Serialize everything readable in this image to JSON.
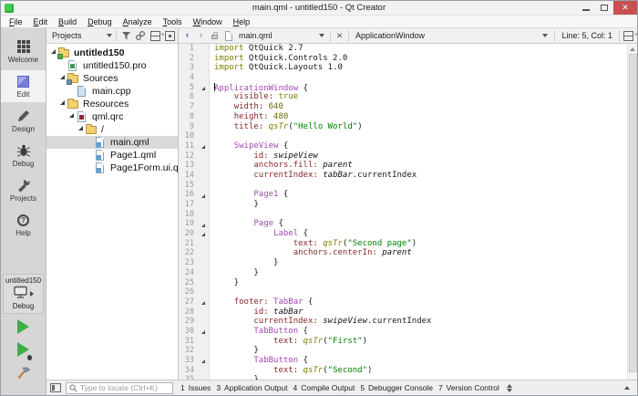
{
  "window": {
    "title": "main.qml - untitled150 - Qt Creator",
    "controls": {
      "minimize": "–",
      "maximize": "▢",
      "close": "✕"
    }
  },
  "menubar": {
    "items": [
      "File",
      "Edit",
      "Build",
      "Debug",
      "Analyze",
      "Tools",
      "Window",
      "Help"
    ]
  },
  "sidebar": {
    "modes": [
      {
        "id": "welcome",
        "label": "Welcome",
        "active": false
      },
      {
        "id": "edit",
        "label": "Edit",
        "active": true
      },
      {
        "id": "design",
        "label": "Design",
        "active": false
      },
      {
        "id": "debug",
        "label": "Debug",
        "active": false
      },
      {
        "id": "projects",
        "label": "Projects",
        "active": false
      },
      {
        "id": "help",
        "label": "Help",
        "active": false
      }
    ],
    "kit": {
      "project": "untitled150",
      "config": "Debug"
    },
    "run_buttons": [
      {
        "id": "run",
        "icon": "run-icon"
      },
      {
        "id": "debug-run",
        "icon": "debug-run-icon"
      },
      {
        "id": "build",
        "icon": "build-hammer-icon"
      }
    ]
  },
  "projects_pane": {
    "header": {
      "selector": "Projects",
      "icons": [
        "filter",
        "link-with-editor",
        "split",
        "close"
      ]
    },
    "tree": [
      {
        "label": "untitled150",
        "depth": 0,
        "icon": "folder-project",
        "expanded": true,
        "bold": true,
        "selected": false
      },
      {
        "label": "untitled150.pro",
        "depth": 1,
        "icon": "file-pro",
        "expanded": null,
        "bold": false,
        "selected": false
      },
      {
        "label": "Sources",
        "depth": 1,
        "icon": "folder-sources",
        "expanded": true,
        "bold": false,
        "selected": false
      },
      {
        "label": "main.cpp",
        "depth": 2,
        "icon": "file-cpp",
        "expanded": null,
        "bold": false,
        "selected": false
      },
      {
        "label": "Resources",
        "depth": 1,
        "icon": "folder-resources",
        "expanded": true,
        "bold": false,
        "selected": false
      },
      {
        "label": "qml.qrc",
        "depth": 2,
        "icon": "file-qrc",
        "expanded": true,
        "bold": false,
        "selected": false
      },
      {
        "label": "/",
        "depth": 3,
        "icon": "folder-plain",
        "expanded": true,
        "bold": false,
        "selected": false
      },
      {
        "label": "main.qml",
        "depth": 4,
        "icon": "file-qml",
        "expanded": null,
        "bold": false,
        "selected": true
      },
      {
        "label": "Page1.qml",
        "depth": 4,
        "icon": "file-qml",
        "expanded": null,
        "bold": false,
        "selected": false
      },
      {
        "label": "Page1Form.ui.qml",
        "depth": 4,
        "icon": "file-qml",
        "expanded": null,
        "bold": false,
        "selected": false
      }
    ]
  },
  "editor": {
    "toolbar": {
      "file_selector": "main.qml",
      "context_selector": "ApplicationWindow",
      "cursor_position": "Line: 5, Col: 1"
    },
    "lines": [
      {
        "n": 1,
        "fold": false,
        "cursor": false,
        "tokens": [
          [
            "kw",
            "import"
          ],
          [
            "pl",
            " QtQuick 2.7"
          ]
        ]
      },
      {
        "n": 2,
        "fold": false,
        "cursor": false,
        "tokens": [
          [
            "kw",
            "import"
          ],
          [
            "pl",
            " QtQuick.Controls 2.0"
          ]
        ]
      },
      {
        "n": 3,
        "fold": false,
        "cursor": false,
        "tokens": [
          [
            "kw",
            "import"
          ],
          [
            "pl",
            " QtQuick.Layouts 1.0"
          ]
        ]
      },
      {
        "n": 4,
        "fold": false,
        "cursor": false,
        "tokens": []
      },
      {
        "n": 5,
        "fold": true,
        "cursor": true,
        "tokens": [
          [
            "ty",
            "ApplicationWindow"
          ],
          [
            "pl",
            " {"
          ]
        ]
      },
      {
        "n": 6,
        "fold": false,
        "cursor": false,
        "tokens": [
          [
            "pl",
            "    "
          ],
          [
            "pr",
            "visible:"
          ],
          [
            "pl",
            " "
          ],
          [
            "kw",
            "true"
          ]
        ]
      },
      {
        "n": 7,
        "fold": false,
        "cursor": false,
        "tokens": [
          [
            "pl",
            "    "
          ],
          [
            "pr",
            "width:"
          ],
          [
            "pl",
            " "
          ],
          [
            "nu",
            "640"
          ]
        ]
      },
      {
        "n": 8,
        "fold": false,
        "cursor": false,
        "tokens": [
          [
            "pl",
            "    "
          ],
          [
            "pr",
            "height:"
          ],
          [
            "pl",
            " "
          ],
          [
            "nu",
            "480"
          ]
        ]
      },
      {
        "n": 9,
        "fold": false,
        "cursor": false,
        "tokens": [
          [
            "pl",
            "    "
          ],
          [
            "pr",
            "title:"
          ],
          [
            "pl",
            " "
          ],
          [
            "fn",
            "qsTr"
          ],
          [
            "pl",
            "("
          ],
          [
            "st",
            "\"Hello World\""
          ],
          [
            "pl",
            ")"
          ]
        ]
      },
      {
        "n": 10,
        "fold": false,
        "cursor": false,
        "tokens": []
      },
      {
        "n": 11,
        "fold": true,
        "cursor": false,
        "tokens": [
          [
            "pl",
            "    "
          ],
          [
            "ty",
            "SwipeView"
          ],
          [
            "pl",
            " {"
          ]
        ]
      },
      {
        "n": 12,
        "fold": false,
        "cursor": false,
        "tokens": [
          [
            "pl",
            "        "
          ],
          [
            "pr",
            "id:"
          ],
          [
            "pl",
            " "
          ],
          [
            "it",
            "swipeView"
          ]
        ]
      },
      {
        "n": 13,
        "fold": false,
        "cursor": false,
        "tokens": [
          [
            "pl",
            "        "
          ],
          [
            "pr",
            "anchors.fill:"
          ],
          [
            "pl",
            " "
          ],
          [
            "it",
            "parent"
          ]
        ]
      },
      {
        "n": 14,
        "fold": false,
        "cursor": false,
        "tokens": [
          [
            "pl",
            "        "
          ],
          [
            "pr",
            "currentIndex:"
          ],
          [
            "pl",
            " "
          ],
          [
            "it",
            "tabBar"
          ],
          [
            "pl",
            ".currentIndex"
          ]
        ]
      },
      {
        "n": 15,
        "fold": false,
        "cursor": false,
        "tokens": []
      },
      {
        "n": 16,
        "fold": true,
        "cursor": false,
        "tokens": [
          [
            "pl",
            "        "
          ],
          [
            "ty",
            "Page1"
          ],
          [
            "pl",
            " {"
          ]
        ]
      },
      {
        "n": 17,
        "fold": false,
        "cursor": false,
        "tokens": [
          [
            "pl",
            "        }"
          ]
        ]
      },
      {
        "n": 18,
        "fold": false,
        "cursor": false,
        "tokens": []
      },
      {
        "n": 19,
        "fold": true,
        "cursor": false,
        "tokens": [
          [
            "pl",
            "        "
          ],
          [
            "ty",
            "Page"
          ],
          [
            "pl",
            " {"
          ]
        ]
      },
      {
        "n": 20,
        "fold": true,
        "cursor": false,
        "tokens": [
          [
            "pl",
            "            "
          ],
          [
            "ty",
            "Label"
          ],
          [
            "pl",
            " {"
          ]
        ]
      },
      {
        "n": 21,
        "fold": false,
        "cursor": false,
        "tokens": [
          [
            "pl",
            "                "
          ],
          [
            "pr",
            "text:"
          ],
          [
            "pl",
            " "
          ],
          [
            "fn",
            "qsTr"
          ],
          [
            "pl",
            "("
          ],
          [
            "st",
            "\"Second page\""
          ],
          [
            "pl",
            ")"
          ]
        ]
      },
      {
        "n": 22,
        "fold": false,
        "cursor": false,
        "tokens": [
          [
            "pl",
            "                "
          ],
          [
            "pr",
            "anchors.centerIn:"
          ],
          [
            "pl",
            " "
          ],
          [
            "it",
            "parent"
          ]
        ]
      },
      {
        "n": 23,
        "fold": false,
        "cursor": false,
        "tokens": [
          [
            "pl",
            "            }"
          ]
        ]
      },
      {
        "n": 24,
        "fold": false,
        "cursor": false,
        "tokens": [
          [
            "pl",
            "        }"
          ]
        ]
      },
      {
        "n": 25,
        "fold": false,
        "cursor": false,
        "tokens": [
          [
            "pl",
            "    }"
          ]
        ]
      },
      {
        "n": 26,
        "fold": false,
        "cursor": false,
        "tokens": []
      },
      {
        "n": 27,
        "fold": true,
        "cursor": false,
        "tokens": [
          [
            "pl",
            "    "
          ],
          [
            "pr",
            "footer:"
          ],
          [
            "pl",
            " "
          ],
          [
            "ty",
            "TabBar"
          ],
          [
            "pl",
            " {"
          ]
        ]
      },
      {
        "n": 28,
        "fold": false,
        "cursor": false,
        "tokens": [
          [
            "pl",
            "        "
          ],
          [
            "pr",
            "id:"
          ],
          [
            "pl",
            " "
          ],
          [
            "it",
            "tabBar"
          ]
        ]
      },
      {
        "n": 29,
        "fold": false,
        "cursor": false,
        "tokens": [
          [
            "pl",
            "        "
          ],
          [
            "pr",
            "currentIndex:"
          ],
          [
            "pl",
            " "
          ],
          [
            "it",
            "swipeView"
          ],
          [
            "pl",
            ".currentIndex"
          ]
        ]
      },
      {
        "n": 30,
        "fold": true,
        "cursor": false,
        "tokens": [
          [
            "pl",
            "        "
          ],
          [
            "ty",
            "TabButton"
          ],
          [
            "pl",
            " {"
          ]
        ]
      },
      {
        "n": 31,
        "fold": false,
        "cursor": false,
        "tokens": [
          [
            "pl",
            "            "
          ],
          [
            "pr",
            "text:"
          ],
          [
            "pl",
            " "
          ],
          [
            "fn",
            "qsTr"
          ],
          [
            "pl",
            "("
          ],
          [
            "st",
            "\"First\""
          ],
          [
            "pl",
            ")"
          ]
        ]
      },
      {
        "n": 32,
        "fold": false,
        "cursor": false,
        "tokens": [
          [
            "pl",
            "        }"
          ]
        ]
      },
      {
        "n": 33,
        "fold": true,
        "cursor": false,
        "tokens": [
          [
            "pl",
            "        "
          ],
          [
            "ty",
            "TabButton"
          ],
          [
            "pl",
            " {"
          ]
        ]
      },
      {
        "n": 34,
        "fold": false,
        "cursor": false,
        "tokens": [
          [
            "pl",
            "            "
          ],
          [
            "pr",
            "text:"
          ],
          [
            "pl",
            " "
          ],
          [
            "fn",
            "qsTr"
          ],
          [
            "pl",
            "("
          ],
          [
            "st",
            "\"Second\""
          ],
          [
            "pl",
            ")"
          ]
        ]
      },
      {
        "n": 35,
        "fold": false,
        "cursor": false,
        "tokens": [
          [
            "pl",
            "        }"
          ]
        ]
      }
    ]
  },
  "statusbar": {
    "locator_placeholder": "Type to locate (Ctrl+K)",
    "panes": [
      {
        "key": "1",
        "label": "Issues"
      },
      {
        "key": "3",
        "label": "Application Output"
      },
      {
        "key": "4",
        "label": "Compile Output"
      },
      {
        "key": "5",
        "label": "Debugger Console"
      },
      {
        "key": "7",
        "label": "Version Control"
      }
    ]
  },
  "colors": {
    "close_button": "#c75050",
    "run_green": "#3fae49",
    "selection_gray": "#d9d9d9",
    "syntax_keyword": "#7d7d00",
    "syntax_type": "#a347b1",
    "syntax_property": "#862727",
    "syntax_string": "#008000",
    "syntax_number": "#6b6b00"
  }
}
